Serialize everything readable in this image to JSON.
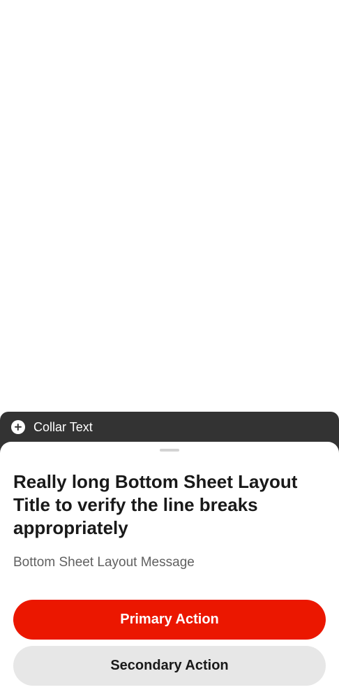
{
  "collar": {
    "icon": "plus-circle-icon",
    "text": "Collar Text"
  },
  "sheet": {
    "title": "Really long Bottom Sheet Layout Title to verify the line breaks appropriately",
    "message": "Bottom Sheet Layout Message",
    "primary_action": "Primary Action",
    "secondary_action": "Secondary Action"
  },
  "colors": {
    "collar_bg": "#333333",
    "primary": "#eb1700",
    "secondary": "#e7e7e7"
  }
}
